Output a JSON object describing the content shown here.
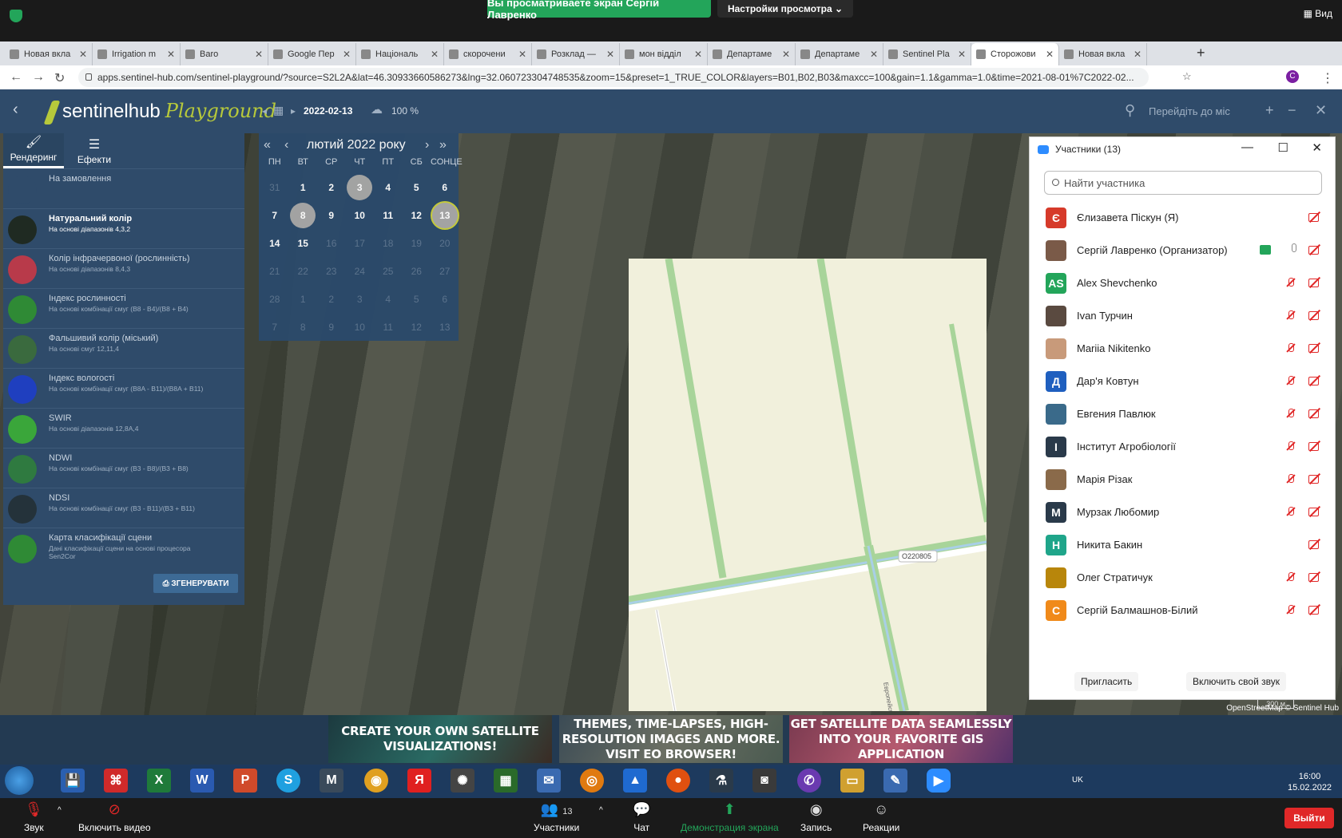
{
  "zoom_top": {
    "share_banner": "Вы просматриваете экран Сергій Лавренко",
    "view_settings": "Настройки просмотра",
    "view_button": "Вид"
  },
  "browser": {
    "tabs": [
      {
        "label": "Новая вкла"
      },
      {
        "label": "Irrigation m"
      },
      {
        "label": "Baro"
      },
      {
        "label": "Google Пер"
      },
      {
        "label": "Національ"
      },
      {
        "label": "скорочени"
      },
      {
        "label": "Розклад —"
      },
      {
        "label": "мон відділ"
      },
      {
        "label": "Департаме"
      },
      {
        "label": "Департаме"
      },
      {
        "label": "Sentinel Pla"
      },
      {
        "label": "Сторожови"
      },
      {
        "label": "Новая вкла"
      }
    ],
    "url": "apps.sentinel-hub.com/sentinel-playground/?source=S2L2A&lat=46.30933660586273&lng=32.060723304748535&zoom=15&preset=1_TRUE_COLOR&layers=B01,B02,B03&maxcc=100&gain=1.1&gamma=1.0&time=2021-08-01%7C2022-02..."
  },
  "sentinel": {
    "logo": "sentinelhub",
    "logo_play": "Playground",
    "date": "2022-02-13",
    "cloud": "100 %",
    "search_placeholder": "Перейдіть до міс"
  },
  "left_panel": {
    "tabs": [
      {
        "label": "Рендеринг",
        "icon": "brush-icon"
      },
      {
        "label": "Ефекти",
        "icon": "sliders-icon"
      }
    ],
    "presets": [
      {
        "title": "На замовлення",
        "sub": "",
        "color": "#2f4b6a"
      },
      {
        "title": "Натуральний колір",
        "sub": "На основі діапазонів 4,3,2",
        "color": "#1f2a22"
      },
      {
        "title": "Колір інфрачервоної (рослинність)",
        "sub": "На основі діапазонів 8,4,3",
        "color": "#b83a4a"
      },
      {
        "title": "Індекс рослинності",
        "sub": "На основі комбінації смуг (B8 - B4)/(B8 + B4)",
        "color": "#2f8a35"
      },
      {
        "title": "Фальшивий колір (міський)",
        "sub": "На основі смуг 12,11,4",
        "color": "#3a6a3e"
      },
      {
        "title": "Індекс вологості",
        "sub": "На основі комбінації смуг (B8A - B11)/(B8A + B11)",
        "color": "#1f3fbf"
      },
      {
        "title": "SWIR",
        "sub": "На основі діапазонів 12,8A,4",
        "color": "#3aa63a"
      },
      {
        "title": "NDWI",
        "sub": "На основі комбінації смуг (B3 - B8)/(B3 + B8)",
        "color": "#2f7a40"
      },
      {
        "title": "NDSI",
        "sub": "На основі комбінації смуг (B3 - B11)/(B3 + B11)",
        "color": "#24323a"
      },
      {
        "title": "Карта класифікації сцени",
        "sub": "Дані класифікації сцени на основі процесора Sen2Cor",
        "color": "#2f8a35"
      }
    ],
    "generate": "ЗГЕНЕРУВАТИ"
  },
  "calendar": {
    "title": "лютий 2022 року",
    "dow": [
      "ПН",
      "ВТ",
      "СР",
      "ЧТ",
      "ПТ",
      "СБ",
      "СОНЦЕ"
    ],
    "days": [
      {
        "d": "31",
        "s": "dim"
      },
      {
        "d": "1",
        "s": ""
      },
      {
        "d": "2",
        "s": ""
      },
      {
        "d": "3",
        "s": "mark"
      },
      {
        "d": "4",
        "s": ""
      },
      {
        "d": "5",
        "s": ""
      },
      {
        "d": "6",
        "s": ""
      },
      {
        "d": "7",
        "s": ""
      },
      {
        "d": "8",
        "s": "mark"
      },
      {
        "d": "9",
        "s": ""
      },
      {
        "d": "10",
        "s": ""
      },
      {
        "d": "11",
        "s": ""
      },
      {
        "d": "12",
        "s": ""
      },
      {
        "d": "13",
        "s": "sel"
      },
      {
        "d": "14",
        "s": ""
      },
      {
        "d": "15",
        "s": ""
      },
      {
        "d": "16",
        "s": "dim"
      },
      {
        "d": "17",
        "s": "dim"
      },
      {
        "d": "18",
        "s": "dim"
      },
      {
        "d": "19",
        "s": "dim"
      },
      {
        "d": "20",
        "s": "dim"
      },
      {
        "d": "21",
        "s": "dim"
      },
      {
        "d": "22",
        "s": "dim"
      },
      {
        "d": "23",
        "s": "dim"
      },
      {
        "d": "24",
        "s": "dim"
      },
      {
        "d": "25",
        "s": "dim"
      },
      {
        "d": "26",
        "s": "dim"
      },
      {
        "d": "27",
        "s": "dim"
      },
      {
        "d": "28",
        "s": "dim"
      },
      {
        "d": "1",
        "s": "dim"
      },
      {
        "d": "2",
        "s": "dim"
      },
      {
        "d": "3",
        "s": "dim"
      },
      {
        "d": "4",
        "s": "dim"
      },
      {
        "d": "5",
        "s": "dim"
      },
      {
        "d": "6",
        "s": "dim"
      },
      {
        "d": "7",
        "s": "dim"
      },
      {
        "d": "8",
        "s": "dim"
      },
      {
        "d": "9",
        "s": "dim"
      },
      {
        "d": "10",
        "s": "dim"
      },
      {
        "d": "11",
        "s": "dim"
      },
      {
        "d": "12",
        "s": "dim"
      },
      {
        "d": "13",
        "s": "dim"
      }
    ]
  },
  "map": {
    "road_label": "O220805",
    "road_label2": "Европейськ",
    "credit": "OpenStreetMap © Sentinel Hub",
    "scale": "300 м"
  },
  "participants": {
    "title": "Участники (13)",
    "search_placeholder": "Найти участника",
    "list": [
      {
        "initial": "Є",
        "name": "Єлизавета Піскун (Я)",
        "color": "#d63a2a",
        "video_off": true,
        "mic_muted": false,
        "sharing": false
      },
      {
        "initial": "",
        "name": "Сергій Лавренко (Организатор)",
        "color": "#7a5a48",
        "video_off": true,
        "mic_muted": false,
        "sharing": true
      },
      {
        "initial": "AS",
        "name": "Alex Shevchenko",
        "color": "#23a55a",
        "video_off": true,
        "mic_muted": true,
        "sharing": false
      },
      {
        "initial": "",
        "name": "Ivan Турчин",
        "color": "#5a4a40",
        "video_off": true,
        "mic_muted": true,
        "sharing": false
      },
      {
        "initial": "",
        "name": "Mariia Nikitenko",
        "color": "#c89a7a",
        "video_off": true,
        "mic_muted": true,
        "sharing": false
      },
      {
        "initial": "Д",
        "name": "Дар'я Ковтун",
        "color": "#1f5fbf",
        "video_off": true,
        "mic_muted": true,
        "sharing": false
      },
      {
        "initial": "",
        "name": "Евгения Павлюк",
        "color": "#3a6a8a",
        "video_off": true,
        "mic_muted": true,
        "sharing": false
      },
      {
        "initial": "І",
        "name": "Інститут Агробіології",
        "color": "#2a3a4a",
        "video_off": true,
        "mic_muted": true,
        "sharing": false
      },
      {
        "initial": "",
        "name": "Марія Різак",
        "color": "#8a6a4a",
        "video_off": true,
        "mic_muted": true,
        "sharing": false
      },
      {
        "initial": "М",
        "name": "Мурзак Любомир",
        "color": "#2a3a4a",
        "video_off": true,
        "mic_muted": true,
        "sharing": false
      },
      {
        "initial": "Н",
        "name": "Никита Бакин",
        "color": "#1fa58a",
        "video_off": true,
        "mic_muted": false,
        "sharing": false
      },
      {
        "initial": "",
        "name": "Олег Стратичук",
        "color": "#b8860b",
        "video_off": true,
        "mic_muted": true,
        "sharing": false
      },
      {
        "initial": "С",
        "name": "Сергій Балмашнов-Білий",
        "color": "#f08a1a",
        "video_off": true,
        "mic_muted": true,
        "sharing": false
      }
    ],
    "invite": "Пригласить",
    "unmute": "Включить свой звук"
  },
  "banners": [
    "CREATE YOUR OWN SATELLITE VISUALIZATIONS!",
    "THEMES, TIME-LAPSES, HIGH-RESOLUTION IMAGES AND MORE. VISIT EO BROWSER!",
    "GET SATELLITE DATA SEAMLESSLY INTO YOUR FAVORITE GIS APPLICATION"
  ],
  "taskbar": {
    "lang": "UK",
    "time": "16:00",
    "date": "15.02.2022"
  },
  "zoom_bottom": {
    "audio": "Звук",
    "video": "Включить видео",
    "participants": "Участники",
    "participants_count": "13",
    "chat": "Чат",
    "share": "Демонстрация экрана",
    "record": "Запись",
    "reactions": "Реакции",
    "leave": "Выйти"
  }
}
